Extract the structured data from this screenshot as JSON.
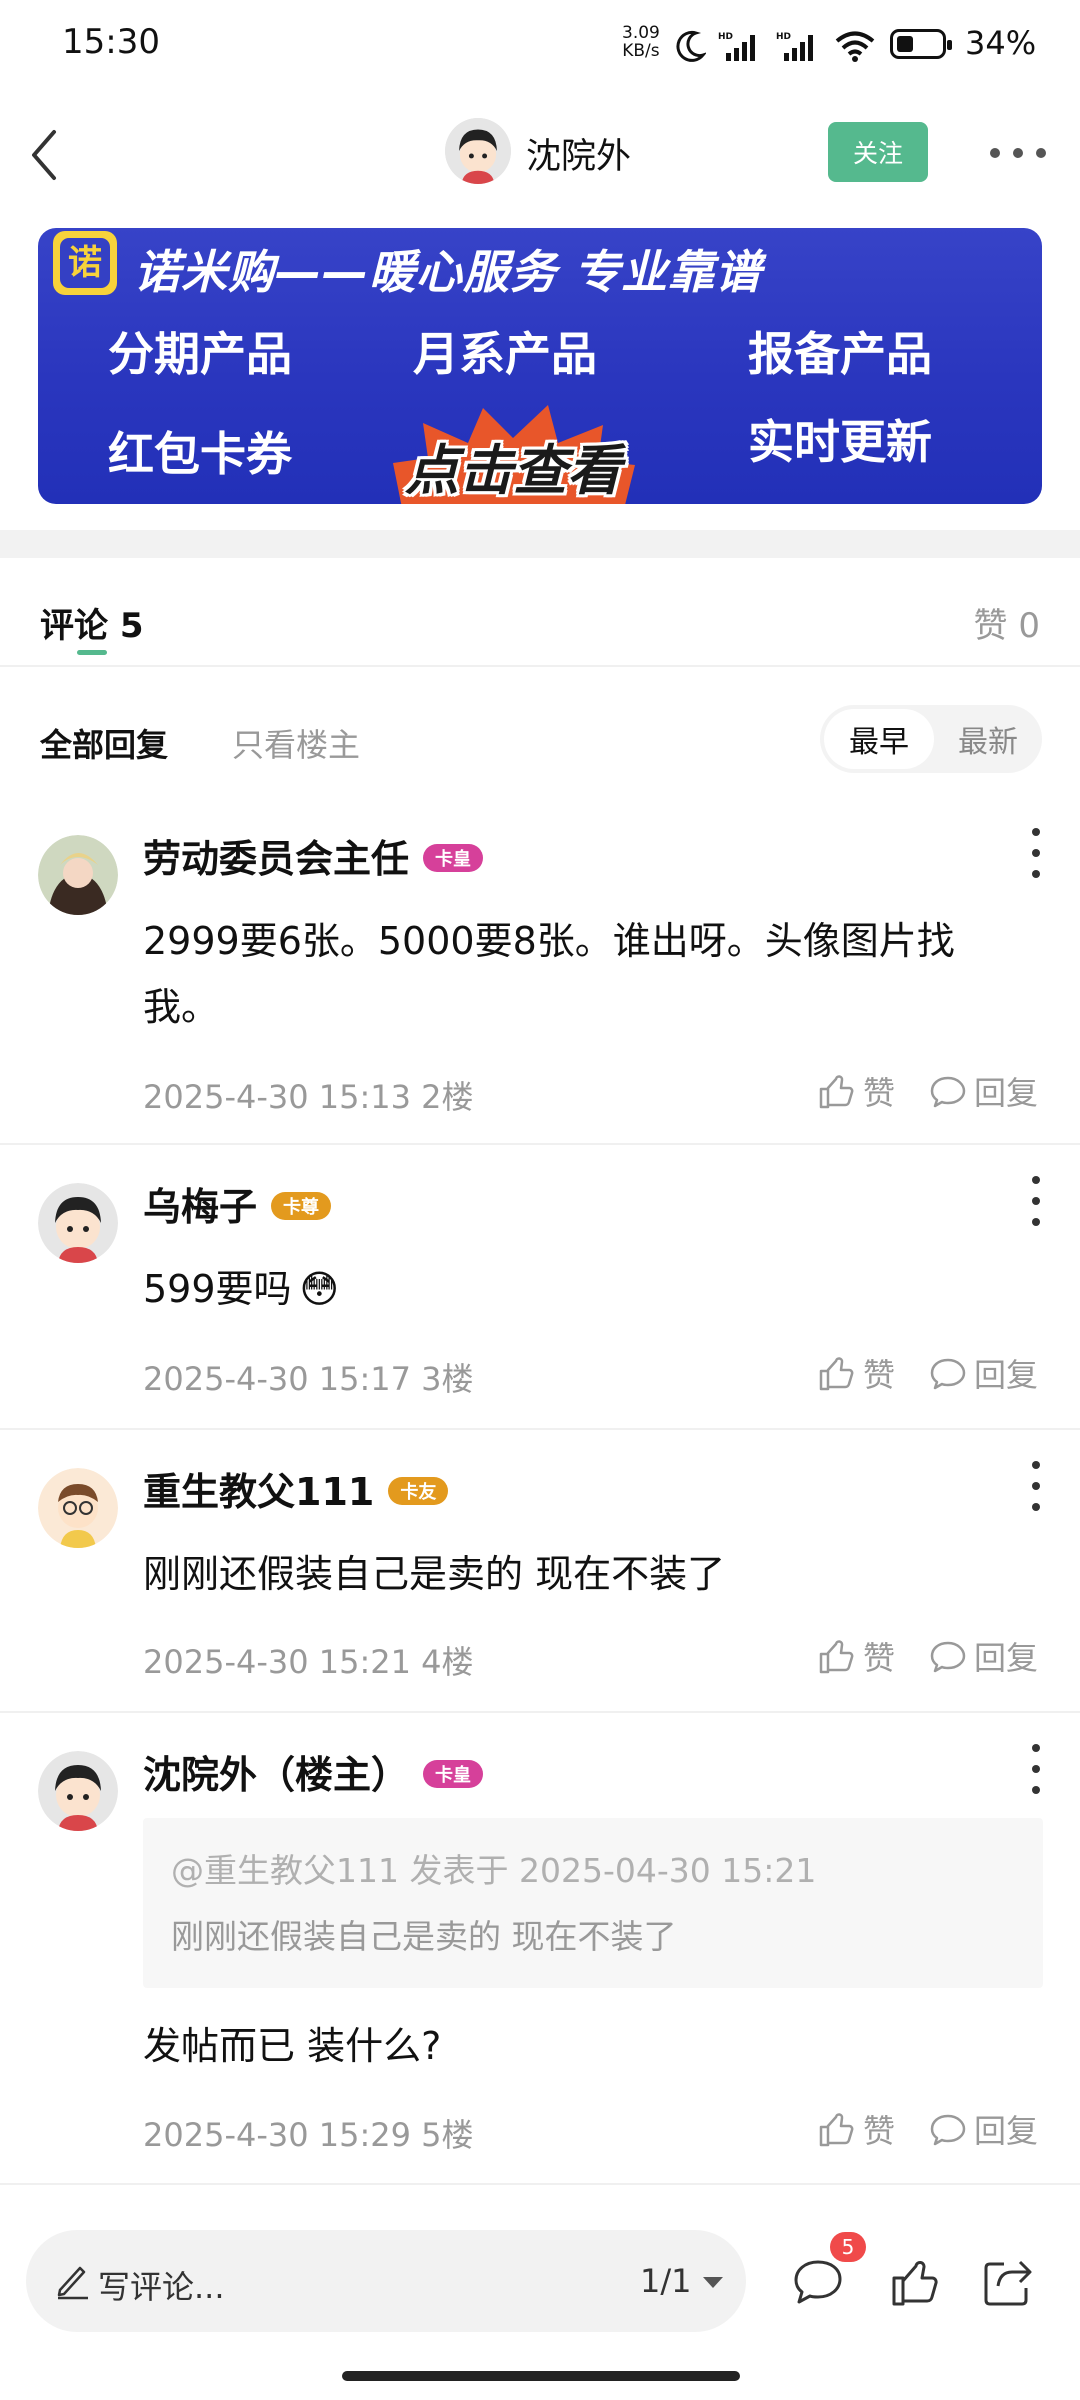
{
  "status_bar": {
    "time": "15:30",
    "net_speed": "3.09",
    "net_unit": "KB/s",
    "battery": "34%"
  },
  "header": {
    "user_name": "沈院外",
    "follow_label": "关注"
  },
  "banner": {
    "logo_char": "诺",
    "title": "诺米购——暖心服务 专业靠谱",
    "items": [
      "分期产品",
      "月系产品",
      "报备产品",
      "红包卡券",
      "实时更新"
    ],
    "cta": "点击查看"
  },
  "comments_tab": {
    "label": "评论",
    "count": "5",
    "likes_label": "赞 0"
  },
  "filters": {
    "all": "全部回复",
    "op_only": "只看楼主",
    "sort_earliest": "最早",
    "sort_latest": "最新"
  },
  "actions": {
    "like": "赞",
    "reply": "回复"
  },
  "comments": [
    {
      "user": "劳动委员会主任",
      "badge": "卡皇",
      "text": "2999要6张。5000要8张。谁出呀。头像图片找我。",
      "date": "2025-4-30 15:13",
      "floor": "2楼"
    },
    {
      "user": "乌梅子",
      "badge": "卡尊",
      "text": "599要吗",
      "emoji": "😳",
      "date": "2025-4-30 15:17",
      "floor": "3楼"
    },
    {
      "user": "重生教父111",
      "badge": "卡友",
      "text": "刚刚还假装自己是卖的 现在不装了",
      "date": "2025-4-30 15:21",
      "floor": "4楼"
    },
    {
      "user": "沈院外（楼主）",
      "badge": "卡皇",
      "quote_header": "@重生教父111 发表于 2025-04-30 15:21",
      "quote_text": "刚刚还假装自己是卖的 现在不装了",
      "text": "发帖而已 装什么?",
      "date": "2025-4-30 15:29",
      "floor": "5楼"
    }
  ],
  "bottom_bar": {
    "placeholder": "写评论...",
    "page": "1/1",
    "comment_count": "5"
  },
  "colors": {
    "accent": "#55b98e",
    "banner_bg": "#2e3ac2",
    "badge_pink": "#d6409a",
    "badge_gold": "#e39a1e",
    "notif_red": "#f04a4a"
  }
}
